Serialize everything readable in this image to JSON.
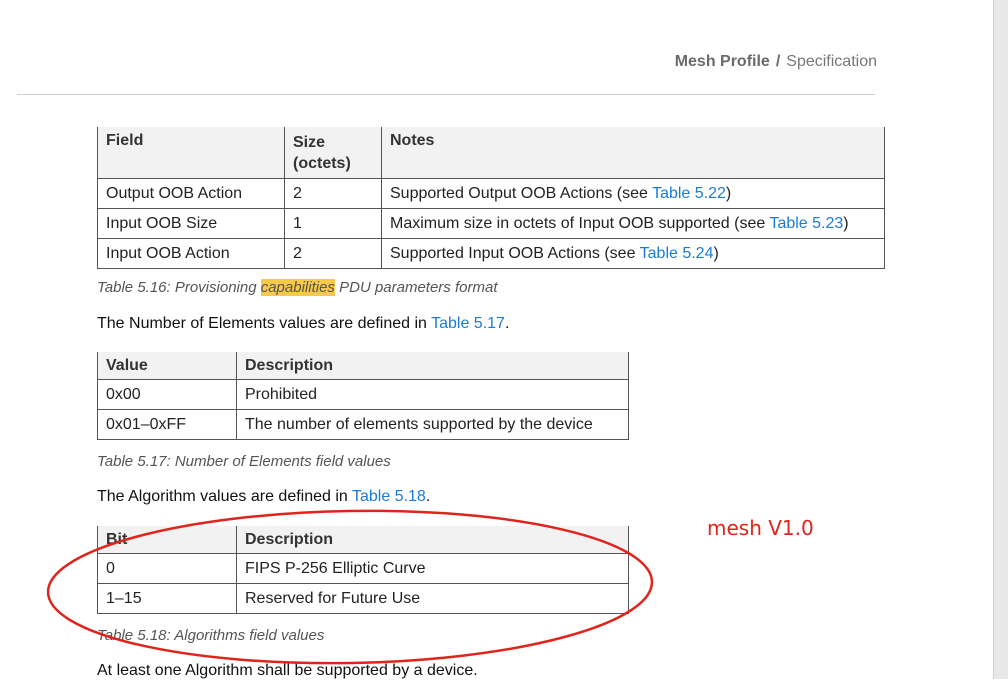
{
  "header": {
    "title": "Mesh Profile",
    "separator": "/",
    "subtitle": "Specification"
  },
  "table1": {
    "headers": [
      "Field",
      "Size\n(octets)",
      "Notes"
    ],
    "rows": [
      {
        "field": "Output OOB Action",
        "size": "2",
        "notes_prefix": "Supported Output OOB Actions (see ",
        "link": "Table 5.22",
        "notes_suffix": ")"
      },
      {
        "field": "Input OOB Size",
        "size": "1",
        "notes_prefix": "Maximum size in octets of Input OOB supported (see ",
        "link": "Table 5.23",
        "notes_suffix": ")"
      },
      {
        "field": "Input OOB Action",
        "size": "2",
        "notes_prefix": "Supported Input OOB Actions (see ",
        "link": "Table 5.24",
        "notes_suffix": ")"
      }
    ],
    "caption_prefix": "Table 5.16: Provisioning ",
    "caption_highlight": "capabilities",
    "caption_suffix": " PDU parameters format"
  },
  "para1": {
    "prefix": "The Number of Elements values are defined in ",
    "link": "Table 5.17",
    "suffix": "."
  },
  "table2": {
    "headers": [
      "Value",
      "Description"
    ],
    "rows": [
      [
        "0x00",
        "Prohibited"
      ],
      [
        "0x01–0xFF",
        "The number of elements supported by the device"
      ]
    ],
    "caption": "Table 5.17: Number of Elements field values"
  },
  "para2": {
    "prefix": "The Algorithm values are defined in ",
    "link": "Table 5.18",
    "suffix": "."
  },
  "table3": {
    "headers": [
      "Bit",
      "Description"
    ],
    "rows": [
      [
        "0",
        "FIPS P-256 Elliptic Curve"
      ],
      [
        "1–15",
        "Reserved for Future Use"
      ]
    ],
    "caption": "Table 5.18: Algorithms field values"
  },
  "para3": {
    "text": "At least one Algorithm shall be supported by a device."
  },
  "annotation": {
    "text": "mesh V1.0",
    "color": "#e0241c"
  }
}
